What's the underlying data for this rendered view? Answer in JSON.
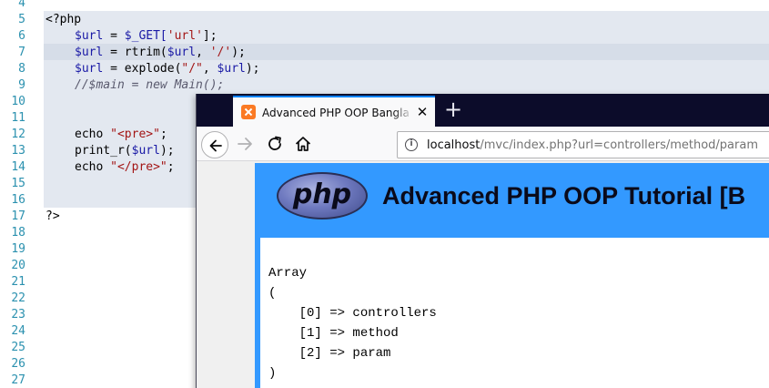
{
  "editor": {
    "line_numbers": [
      "4",
      "5",
      "6",
      "7",
      "8",
      "9",
      "10",
      "11",
      "12",
      "13",
      "14",
      "15",
      "16",
      "17",
      "18",
      "19",
      "20",
      "21",
      "22",
      "23",
      "24",
      "25",
      "26",
      "27"
    ],
    "lines": {
      "l5_open": "<?php",
      "l6_var": "$url",
      "l6_mid": " = ",
      "l6_fn": "$_GET[",
      "l6_str": "'url'",
      "l6_end": "];",
      "l7_var": "$url",
      "l7_mid": " = rtrim(",
      "l7_var2": "$url",
      "l7_sep": ", ",
      "l7_str": "'/'",
      "l7_end": ");",
      "l8_var": "$url",
      "l8_mid": " = explode(",
      "l8_str": "\"/\"",
      "l8_sep": ", ",
      "l8_var2": "$url",
      "l8_end": ");",
      "l9_comment": "//$main = new Main();",
      "l12_kw": "echo ",
      "l12_str": "\"<pre>\"",
      "l12_end": ";",
      "l13_fn": "print_r(",
      "l13_var": "$url",
      "l13_end": ");",
      "l14_kw": "echo ",
      "l14_str": "\"</pre>\"",
      "l14_end": ";",
      "l17_close": "?>"
    }
  },
  "browser": {
    "tab_title": "Advanced PHP OOP Bangla Tu",
    "tab_close": "✕",
    "new_tab": "+",
    "url_host": "localhost",
    "url_path": "/mvc/index.php?url=controllers/method/param",
    "info_icon": "i",
    "page": {
      "logo_text": "php",
      "banner_title": "Advanced PHP OOP Tutorial [B",
      "output_lines": [
        "Array",
        "(",
        "    [0] => controllers",
        "    [1] => method",
        "    [2] => param",
        ")"
      ]
    }
  },
  "colors": {
    "accent_tab": "#0a84ff",
    "page_blue": "#3399ff",
    "selection": "#e3e8f0",
    "line_number": "#2b91af"
  }
}
